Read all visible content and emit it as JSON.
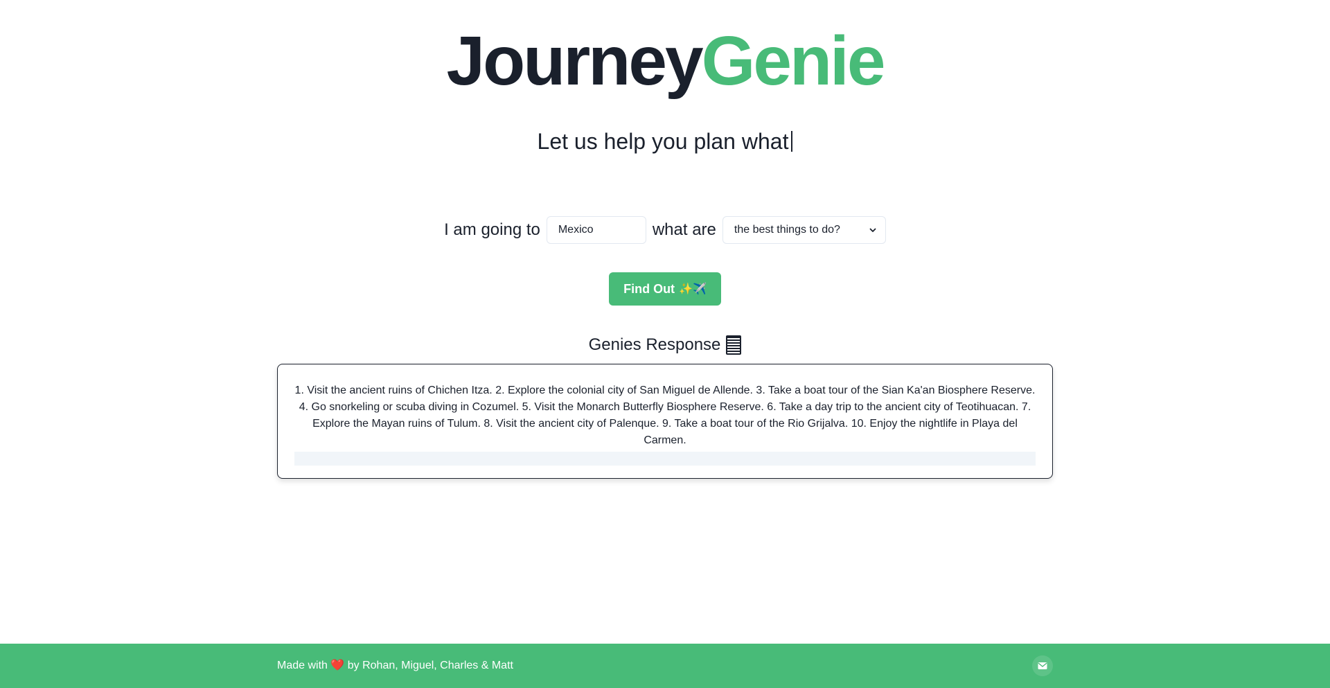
{
  "brand": {
    "part1": "Journey",
    "part2": "Genie"
  },
  "tagline": "Let us help you plan what",
  "query": {
    "prefix": "I am going to",
    "destination_value": "Mexico",
    "middle": "what are",
    "select_value": "the best things to do?"
  },
  "actions": {
    "find_label": "Find Out",
    "find_emoji": "✨✈️"
  },
  "response": {
    "heading": "Genies Response",
    "heading_icon": "list-icon",
    "text": "1. Visit the ancient ruins of Chichen Itza. 2. Explore the colonial city of San Miguel de Allende. 3. Take a boat tour of the Sian Ka'an Biosphere Reserve. 4. Go snorkeling or scuba diving in Cozumel. 5. Visit the Monarch Butterfly Biosphere Reserve. 6. Take a day trip to the ancient city of Teotihuacan. 7. Explore the Mayan ruins of Tulum. 8. Visit the ancient city of Palenque. 9. Take a boat tour of the Rio Grijalva. 10. Enjoy the nightlife in Playa del Carmen."
  },
  "footer": {
    "made_with": "Made with",
    "heart": "❤️",
    "credits": "by Rohan, Miguel, Charles & Matt",
    "icon": "mail-icon"
  },
  "colors": {
    "accent": "#48bb78",
    "text": "#1a202c",
    "border": "#e2e8f0"
  }
}
